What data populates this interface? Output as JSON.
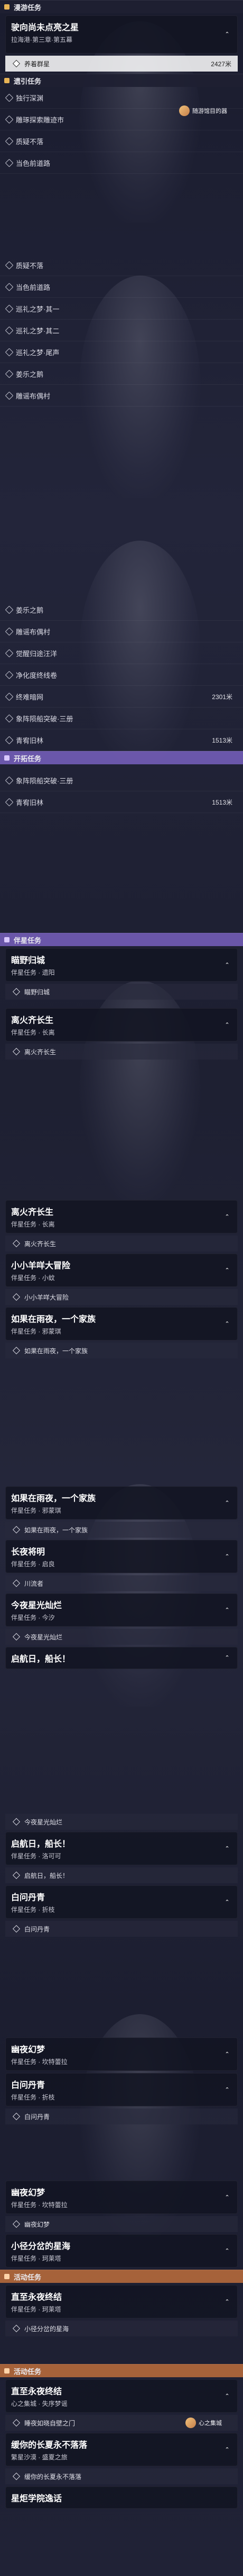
{
  "sections": {
    "pioneer": "漫游任务",
    "companion": "遗引任务",
    "trailblaze": "开拓任务",
    "companion_mission": "伴星任务",
    "event": "活动任务"
  },
  "screens": [
    {
      "id": "s1",
      "header": "漫游任务",
      "card": {
        "title": "驶向尚未点亮之星",
        "subtitle": "拉海港·第三章·第五幕",
        "chevron": "⌃"
      },
      "active_item": {
        "label": "养着群星",
        "distance": "2427米"
      },
      "header2": "遗引任务",
      "items": [
        {
          "label": "独行深渊"
        },
        {
          "label": "雕琢探索雕迹市"
        },
        {
          "label": "质疑不落"
        },
        {
          "label": "当色前道路"
        }
      ],
      "badge": "随游馆目的器"
    },
    {
      "id": "s2",
      "items": [
        {
          "label": "质疑不落"
        },
        {
          "label": "当色前道路"
        },
        {
          "label": "巡礼之梦·其一"
        },
        {
          "label": "巡礼之梦·其二"
        },
        {
          "label": "巡礼之梦·尾声"
        },
        {
          "label": "姜乐之鹅"
        },
        {
          "label": "雕谣布偶村"
        }
      ]
    },
    {
      "id": "s3",
      "items": [
        {
          "label": "姜乐之鹅"
        },
        {
          "label": "雕谣布偶村"
        },
        {
          "label": "觉醒归途汪洋"
        },
        {
          "label": "净化度终线卷"
        },
        {
          "label": "终难暗网",
          "distance": "2301米"
        },
        {
          "label": "象阵陨船突破·三册"
        },
        {
          "label": "青宥旧林",
          "distance": "1513米"
        }
      ],
      "header2": "开拓任务",
      "items2": [
        {
          "label": "象阵陨船突破·三册"
        },
        {
          "label": "青宥旧林",
          "distance": "1513米"
        }
      ]
    },
    {
      "id": "s4",
      "header": "伴星任务",
      "cards": [
        {
          "title": "瞄野归城",
          "subtitle": "伴星任务 · 遗阳",
          "chevron": "⌃",
          "subs": [
            "瞄野归城"
          ]
        },
        {
          "title": "离火齐长生",
          "subtitle": "伴星任务 · 长离",
          "chevron": "⌃",
          "subs": [
            "离火齐长生"
          ]
        }
      ]
    },
    {
      "id": "s5",
      "cards": [
        {
          "title": "离火齐长生",
          "subtitle": "伴星任务 · 长离",
          "chevron": "⌃",
          "subs": [
            "离火齐长生"
          ]
        },
        {
          "title": "小小羊咩大冒险",
          "subtitle": "伴星任务 · 小蚊",
          "chevron": "⌃",
          "subs": [
            "小小羊咩大冒险"
          ]
        },
        {
          "title": "如果在雨夜，一个家族",
          "subtitle": "伴星任务 · 邪蒙琪",
          "chevron": "⌃",
          "subs": [
            "如果在雨夜，一个家族"
          ]
        }
      ]
    },
    {
      "id": "s6",
      "cards": [
        {
          "title": "如果在雨夜，一个家族",
          "subtitle": "伴星任务 · 邪蒙琪",
          "chevron": "⌃",
          "subs": [
            "如果在雨夜，一个家族"
          ]
        },
        {
          "title": "长夜将明",
          "subtitle": "伴星任务 · 启良",
          "chevron": "⌃",
          "subs": [
            "川流者"
          ]
        },
        {
          "title": "今夜星光灿烂",
          "subtitle": "伴星任务 · 今汐",
          "chevron": "⌃",
          "subs": [
            "今夜星光灿烂"
          ]
        },
        {
          "title": "启航日，船长！",
          "subtitle": "",
          "chevron": "⌃",
          "subs": []
        }
      ]
    },
    {
      "id": "s7",
      "cards": [
        {
          "title": "启航日，船长！",
          "subtitle": "伴星任务 · 洛可可",
          "chevron": "⌃",
          "subs": [
            "今夜星光灿烂",
            "启航日，船长！"
          ]
        },
        {
          "title": "白问丹青",
          "subtitle": "伴星任务 · 折枝",
          "chevron": "⌃",
          "subs": [
            "白问丹青"
          ]
        }
      ]
    },
    {
      "id": "s8",
      "cards": [
        {
          "title": "幽夜幻梦",
          "subtitle": "伴星任务 · 坎特蕾拉",
          "chevron": "⌃",
          "subs": []
        },
        {
          "title": "白问丹青",
          "subtitle": "伴星任务 · 折枝",
          "chevron": "⌃",
          "subs": [
            "白问丹青"
          ]
        }
      ]
    },
    {
      "id": "s9",
      "cards": [
        {
          "title": "幽夜幻梦",
          "subtitle": "伴星任务 · 坎特蕾拉",
          "chevron": "⌃",
          "subs": [
            "幽夜幻梦"
          ]
        },
        {
          "title": "小径分岔的星海",
          "subtitle": "伴星任务 · 珂莱塔",
          "chevron": "⌃",
          "subs": []
        }
      ],
      "header2": "活动任务",
      "cards2": [
        {
          "title": "直至永夜终结",
          "subtitle": "伴星任务 · 珂莱塔",
          "chevron": "⌃",
          "subs": [
            "小径分岔的星海"
          ]
        }
      ]
    },
    {
      "id": "s10",
      "header": "活动任务",
      "cards": [
        {
          "title": "直至永夜终结",
          "subtitle": "心之集城 · 失序梦谣",
          "chevron": "⌃",
          "subs": [
            "睡夜如晓自壁之门"
          ]
        },
        {
          "title": "缓你的长夏永不落落",
          "subtitle": "繁星沙漠 · 盛夏之旅",
          "chevron": "⌃",
          "subs": [
            "缓你的长夏永不落落"
          ]
        },
        {
          "title": "星炬学院逸话",
          "subtitle": "",
          "chevron": "",
          "subs": []
        }
      ],
      "badge": "心之集城"
    }
  ]
}
